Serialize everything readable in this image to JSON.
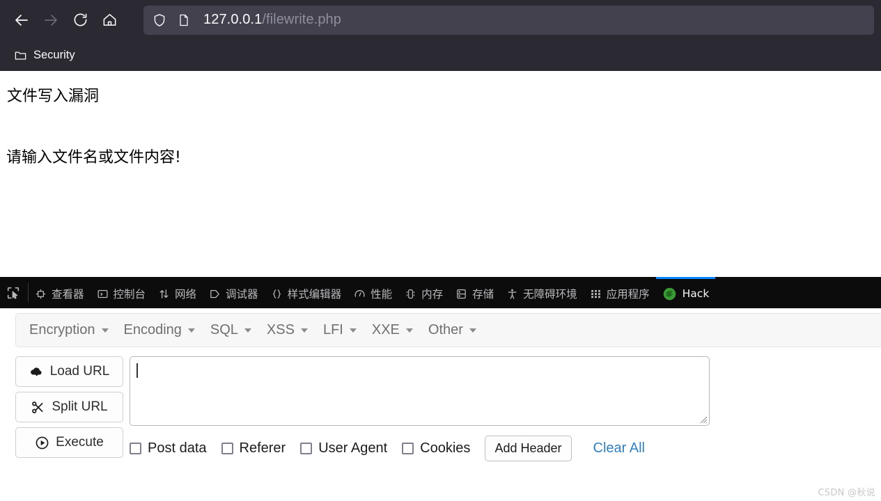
{
  "browser": {
    "nav": {
      "back_label": "Back",
      "forward_label": "Forward",
      "reload_label": "Reload",
      "home_label": "Home"
    },
    "urlbar": {
      "host": "127.0.0.1",
      "path": "/filewrite.php",
      "shield_icon": "shield-icon",
      "page_icon": "page-icon"
    },
    "bookmarks": [
      {
        "label": "Security",
        "icon": "folder-icon"
      }
    ]
  },
  "page": {
    "heading": "文件写入漏洞",
    "prompt": "请输入文件名或文件内容!"
  },
  "devtools": {
    "picker_icon": "element-picker-icon",
    "tabs": [
      {
        "label": "查看器",
        "icon": "inspector-icon",
        "active": false
      },
      {
        "label": "控制台",
        "icon": "console-icon",
        "active": false
      },
      {
        "label": "网络",
        "icon": "network-icon",
        "active": false
      },
      {
        "label": "调试器",
        "icon": "debugger-icon",
        "active": false
      },
      {
        "label": "样式编辑器",
        "icon": "style-editor-icon",
        "active": false
      },
      {
        "label": "性能",
        "icon": "performance-icon",
        "active": false
      },
      {
        "label": "内存",
        "icon": "memory-icon",
        "active": false
      },
      {
        "label": "存储",
        "icon": "storage-icon",
        "active": false
      },
      {
        "label": "无障碍环境",
        "icon": "accessibility-icon",
        "active": false
      },
      {
        "label": "应用程序",
        "icon": "application-icon",
        "active": false
      },
      {
        "label": "Hack",
        "icon": "hackbar-icon",
        "active": true
      }
    ]
  },
  "hackbar": {
    "menus": [
      {
        "label": "Encryption"
      },
      {
        "label": "Encoding"
      },
      {
        "label": "SQL"
      },
      {
        "label": "XSS"
      },
      {
        "label": "LFI"
      },
      {
        "label": "XXE"
      },
      {
        "label": "Other"
      }
    ],
    "buttons": [
      {
        "label": "Load URL",
        "icon": "cloud-download-icon"
      },
      {
        "label": "Split URL",
        "icon": "scissors-icon"
      },
      {
        "label": "Execute",
        "icon": "play-circle-icon"
      }
    ],
    "url_input": {
      "value": "",
      "placeholder": ""
    },
    "checkboxes": [
      {
        "label": "Post data",
        "checked": false
      },
      {
        "label": "Referer",
        "checked": false
      },
      {
        "label": "User Agent",
        "checked": false
      },
      {
        "label": "Cookies",
        "checked": false
      }
    ],
    "add_header_label": "Add Header",
    "clear_all_label": "Clear All",
    "accent_link_color": "#2f7fc1"
  },
  "watermark": "CSDN @秋说"
}
